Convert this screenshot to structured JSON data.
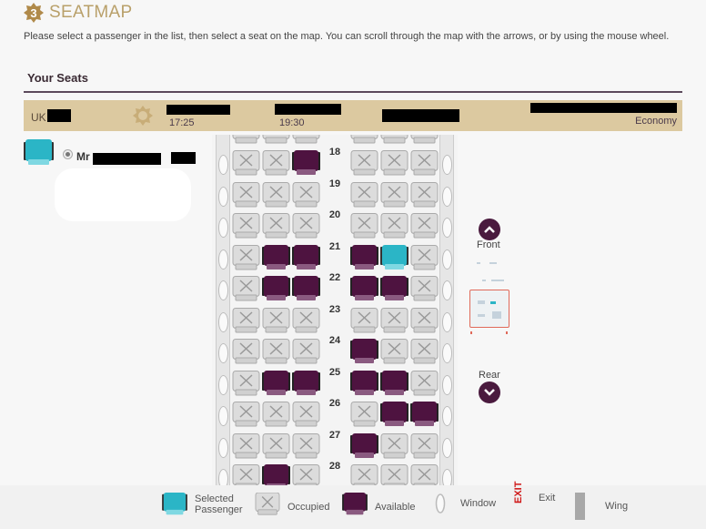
{
  "header": {
    "step_number": "3",
    "title": "SEATMAP",
    "instructions": "Please select a passenger in the list, then select a seat on the map. You can scroll through the map with the arrows, or by using the mouse wheel."
  },
  "section": {
    "title": "Your Seats"
  },
  "flight": {
    "origin_prefix": "UK",
    "departure_time": "17:25",
    "arrival_time": "19:30",
    "cabin_class": "Economy",
    "icon": "sun-icon"
  },
  "passenger": {
    "title": "Mr",
    "selected": true,
    "icon": "seat-selected-icon"
  },
  "seatmap": {
    "colors": {
      "available": "#4e1340",
      "occupied": "#dcdcdc",
      "selected": "#2bb5c6",
      "wall": "#e6e6e6"
    },
    "rows": [
      {
        "number": "18",
        "left": [
          "occupied",
          "occupied",
          "available"
        ],
        "right": [
          "occupied",
          "occupied",
          "occupied"
        ]
      },
      {
        "number": "19",
        "left": [
          "occupied",
          "occupied",
          "occupied"
        ],
        "right": [
          "occupied",
          "occupied",
          "occupied"
        ]
      },
      {
        "number": "20",
        "left": [
          "occupied",
          "occupied",
          "occupied"
        ],
        "right": [
          "occupied",
          "occupied",
          "occupied"
        ]
      },
      {
        "number": "21",
        "left": [
          "occupied",
          "available",
          "available"
        ],
        "right": [
          "available",
          "selected",
          "occupied"
        ]
      },
      {
        "number": "22",
        "left": [
          "occupied",
          "available",
          "available"
        ],
        "right": [
          "available",
          "available",
          "occupied"
        ]
      },
      {
        "number": "23",
        "left": [
          "occupied",
          "occupied",
          "occupied"
        ],
        "right": [
          "occupied",
          "occupied",
          "occupied"
        ]
      },
      {
        "number": "24",
        "left": [
          "occupied",
          "occupied",
          "occupied"
        ],
        "right": [
          "available",
          "occupied",
          "occupied"
        ]
      },
      {
        "number": "25",
        "left": [
          "occupied",
          "available",
          "available"
        ],
        "right": [
          "available",
          "available",
          "occupied"
        ]
      },
      {
        "number": "26",
        "left": [
          "occupied",
          "occupied",
          "occupied"
        ],
        "right": [
          "occupied",
          "available",
          "available"
        ]
      },
      {
        "number": "27",
        "left": [
          "occupied",
          "occupied",
          "occupied"
        ],
        "right": [
          "available",
          "occupied",
          "occupied"
        ]
      },
      {
        "number": "28",
        "left": [
          "occupied",
          "available",
          "occupied"
        ],
        "right": [
          "occupied",
          "occupied",
          "occupied"
        ]
      }
    ]
  },
  "navigation": {
    "front_label": "Front",
    "rear_label": "Rear"
  },
  "legend": {
    "selected_line1": "Selected",
    "selected_line2": "Passenger",
    "occupied": "Occupied",
    "available": "Available",
    "window": "Window",
    "exit_sign": "EXIT",
    "exit": "Exit",
    "wing": "Wing"
  }
}
